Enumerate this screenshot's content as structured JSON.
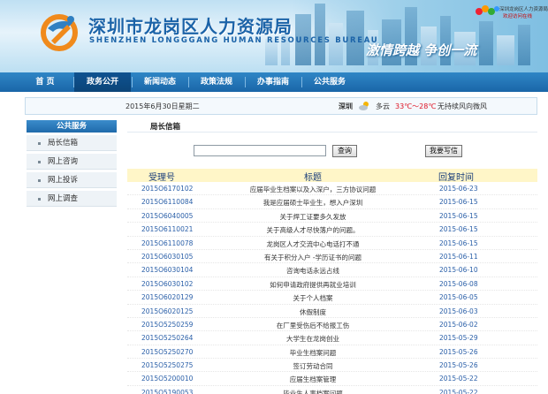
{
  "header": {
    "title": "深圳市龙岗区人力资源局",
    "subtitle": "SHENZHEN LONGGGANG HUMAN RESOURCES BUREAU",
    "slogan": "激情跨越 争创一流",
    "badge_line1": "深圳龙岗区人力资源局",
    "badge_line2": "欢迎访问在线"
  },
  "nav": {
    "items": [
      {
        "label": "首 页"
      },
      {
        "label": "政务公开"
      },
      {
        "label": "新闻动态"
      },
      {
        "label": "政策法规"
      },
      {
        "label": "办事指南"
      },
      {
        "label": "公共服务"
      }
    ]
  },
  "infobar": {
    "date": "2015年6月30日星期二",
    "city": "深圳",
    "condition": "多云",
    "temperature": "33℃～28℃",
    "wind": "无持续风向微风"
  },
  "sidebar": {
    "heading": "公共服务",
    "items": [
      {
        "label": "局长信箱"
      },
      {
        "label": "网上咨询"
      },
      {
        "label": "网上投诉"
      },
      {
        "label": "网上调查"
      }
    ]
  },
  "content": {
    "title": "局长信箱",
    "search_placeholder": "",
    "query_label": "查询",
    "write_label": "我要写信"
  },
  "table": {
    "headers": [
      "受理号",
      "标题",
      "回复时间"
    ],
    "rows": [
      {
        "id": "2015O6170102",
        "title": "应届毕业生档案以及入深户，三方协议问题",
        "date": "2015-06-23"
      },
      {
        "id": "2015O6110084",
        "title": "我是应届硕士毕业生，想入户深圳",
        "date": "2015-06-15"
      },
      {
        "id": "2015O6040005",
        "title": "关于焊工证要多久发放",
        "date": "2015-06-15"
      },
      {
        "id": "2015O6110021",
        "title": "关于高级人才尽快落户的问题。",
        "date": "2015-06-15"
      },
      {
        "id": "2015O6110078",
        "title": "龙岗区人才交流中心电话打不通",
        "date": "2015-06-15"
      },
      {
        "id": "2015O6030105",
        "title": "有关于积分入户 -学历证书的问题",
        "date": "2015-06-11"
      },
      {
        "id": "2015O6030104",
        "title": "咨询电话永远占线",
        "date": "2015-06-10"
      },
      {
        "id": "2015O6030102",
        "title": "如何申请政府提供再就业培训",
        "date": "2015-06-08"
      },
      {
        "id": "2015O6020129",
        "title": "关于个人档案",
        "date": "2015-06-05"
      },
      {
        "id": "2015O6020125",
        "title": "休假制度",
        "date": "2015-06-03"
      },
      {
        "id": "2015O5250259",
        "title": "在厂里受伤后不给报工伤",
        "date": "2015-06-02"
      },
      {
        "id": "2015O5250264",
        "title": "大学生在龙岗创业",
        "date": "2015-05-29"
      },
      {
        "id": "2015O5250270",
        "title": "毕业生档案问题",
        "date": "2015-05-26"
      },
      {
        "id": "2015O5250275",
        "title": "签订劳动合同",
        "date": "2015-05-26"
      },
      {
        "id": "2015O5200010",
        "title": "应届生档案管理",
        "date": "2015-05-22"
      },
      {
        "id": "2015O5190053",
        "title": "毕业生人事档案问题",
        "date": "2015-05-22"
      }
    ]
  },
  "colors": {
    "nav_blue": "#1a66a8",
    "nav_active": "#0f5391",
    "link_blue": "#2a5fa8",
    "table_header_bg": "#fff6c8",
    "temp_red": "#dd1122",
    "logo_orange": "#f08a1c"
  },
  "icons": {
    "logo": "bureau-logo-icon",
    "weather": "cloud-sun-icon",
    "list_bullet": "square-bullet-icon"
  }
}
